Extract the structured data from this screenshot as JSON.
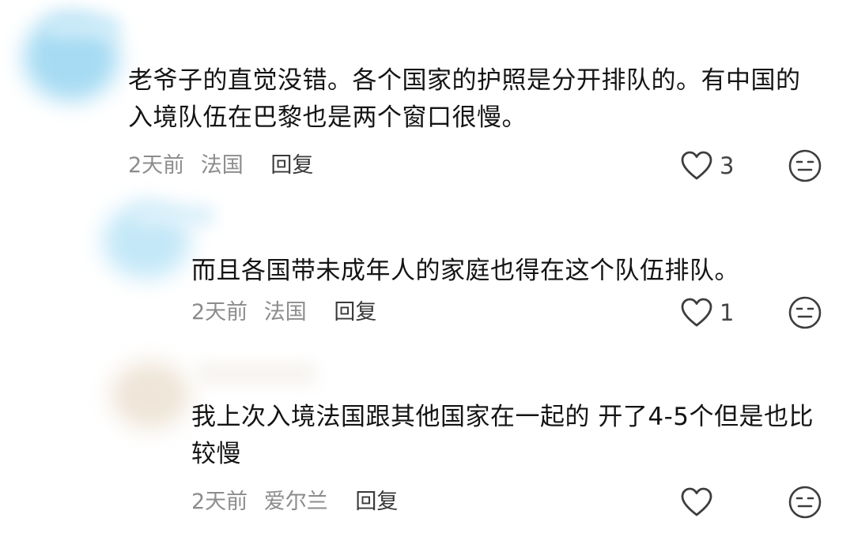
{
  "comments": [
    {
      "text": "老爷子的直觉没错。各个国家的护照是分开排队的。有中国的入境队伍在巴黎也是两个窗口很慢。",
      "time": "2天前",
      "location": "法国",
      "reply_label": "回复",
      "likes": "3"
    },
    {
      "text": "而且各国带未成年人的家庭也得在这个队伍排队。",
      "time": "2天前",
      "location": "法国",
      "reply_label": "回复",
      "likes": "1"
    },
    {
      "text": "我上次入境法国跟其他国家在一起的 开了4-5个但是也比较慢",
      "time": "2天前",
      "location": "爱尔兰",
      "reply_label": "回复",
      "likes": ""
    }
  ],
  "icons": {
    "like": "heart-outline-icon",
    "dislike": "neutral-face-icon"
  },
  "colors": {
    "text": "#141414",
    "meta": "#8c8c8c",
    "icon": "#3d3d3d",
    "avatar_blur_1": "#9fd8f2",
    "avatar_blur_2": "#bfe6f7",
    "avatar_blur_3": "#efe6da"
  }
}
